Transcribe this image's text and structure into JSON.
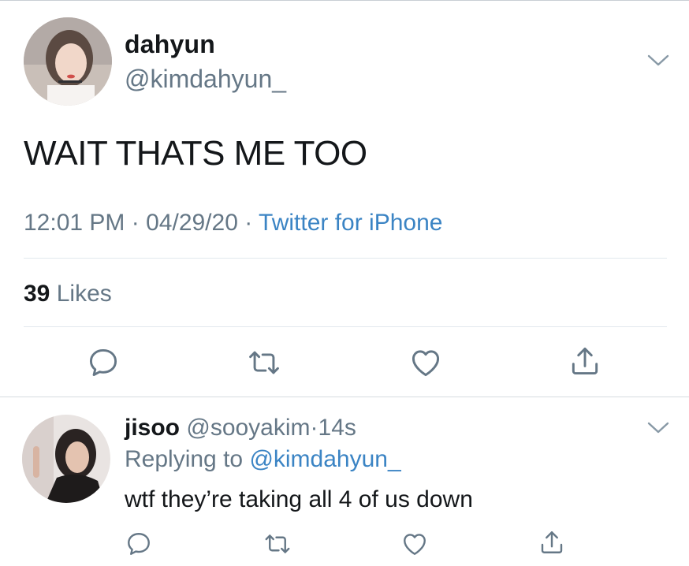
{
  "main_tweet": {
    "display_name": "dahyun",
    "handle": "@kimdahyun_",
    "text": "WAIT THATS ME TOO",
    "time": "12:01 PM",
    "separator": "·",
    "date": "04/29/20",
    "source": "Twitter for iPhone",
    "likes_count": "39",
    "likes_label": "Likes"
  },
  "reply": {
    "display_name": "jisoo",
    "handle": "@sooyakim",
    "separator": "·",
    "age": "14s",
    "replying_prefix": "Replying to",
    "replying_to": "@kimdahyun_",
    "text": "wtf they’re taking all 4 of us down"
  },
  "icons": {
    "reply": "comment-bubble-icon",
    "retweet": "retweet-icon",
    "like": "heart-icon",
    "share": "share-icon",
    "menu": "chevron-down-icon"
  },
  "colors": {
    "link": "#3b84c4",
    "secondary_text": "#657786",
    "primary_text": "#14171a"
  }
}
